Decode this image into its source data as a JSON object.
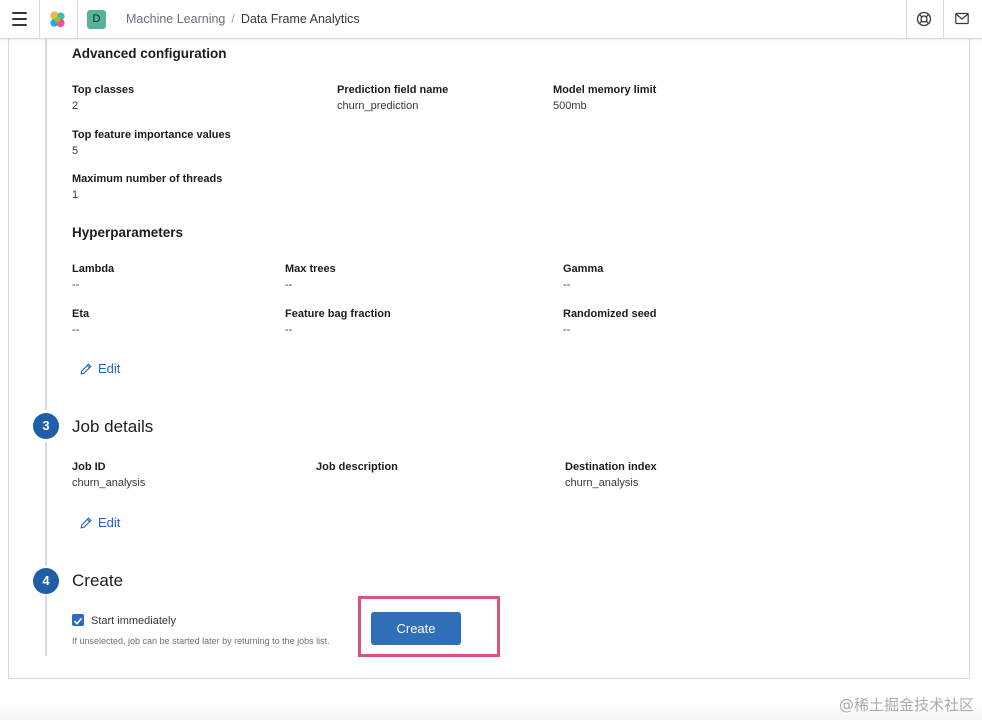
{
  "header": {
    "space_initial": "D",
    "breadcrumbs": [
      "Machine Learning",
      "Data Frame Analytics"
    ],
    "icons": [
      "menu-icon",
      "elastic-logo",
      "help-icon",
      "mail-icon"
    ]
  },
  "advanced": {
    "title": "Advanced configuration",
    "fields": [
      {
        "label": "Top classes",
        "value": "2"
      },
      {
        "label": "Prediction field name",
        "value": "churn_prediction"
      },
      {
        "label": "Model memory limit",
        "value": "500mb"
      },
      {
        "label": "Top feature importance values",
        "value": "5"
      },
      {
        "label": "Maximum number of threads",
        "value": "1"
      }
    ]
  },
  "hyperparameters": {
    "title": "Hyperparameters",
    "fields": [
      {
        "label": "Lambda",
        "value": "--"
      },
      {
        "label": "Max trees",
        "value": "--"
      },
      {
        "label": "Gamma",
        "value": "--"
      },
      {
        "label": "Eta",
        "value": "--"
      },
      {
        "label": "Feature bag fraction",
        "value": "--"
      },
      {
        "label": "Randomized seed",
        "value": "--"
      }
    ],
    "edit_label": "Edit"
  },
  "job_details": {
    "step_number": "3",
    "title": "Job details",
    "fields": [
      {
        "label": "Job ID",
        "value": "churn_analysis"
      },
      {
        "label": "Job description",
        "value": ""
      },
      {
        "label": "Destination index",
        "value": "churn_analysis"
      }
    ],
    "edit_label": "Edit"
  },
  "create": {
    "step_number": "4",
    "title": "Create",
    "checkbox_label": "Start immediately",
    "checkbox_checked": true,
    "help_text": "If unselected, job can be started later by returning to the jobs list.",
    "button_label": "Create"
  },
  "watermark": "@稀土掘金技术社区",
  "colors": {
    "accent": "#2f6fb8",
    "step_circle": "#1f5fa8",
    "highlight_border": "#d6547e",
    "link": "#1f63b8"
  }
}
